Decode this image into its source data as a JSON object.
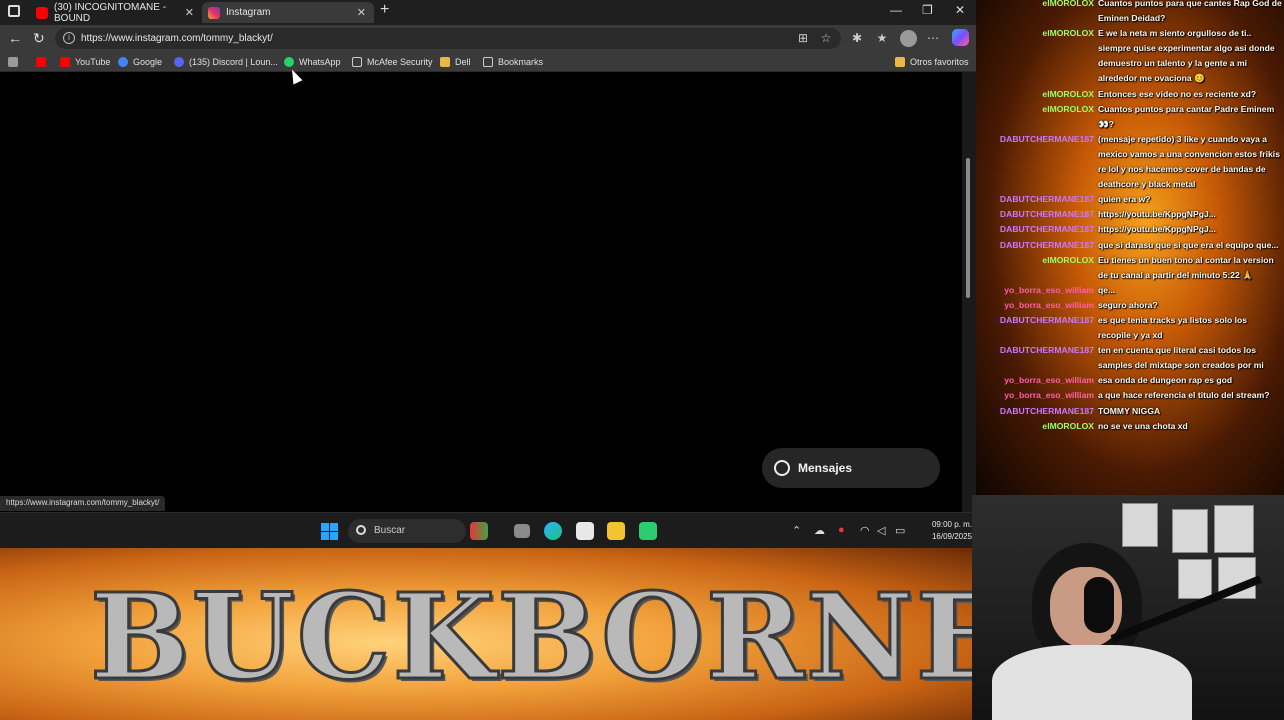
{
  "browser": {
    "tabs": [
      {
        "label": "(30) INCOGNITOMANE - BOUND",
        "favicon_color": "#ff0000"
      },
      {
        "label": "Instagram",
        "favicon_color": "#e1306c"
      }
    ],
    "url": "https://www.instagram.com/tommy_blackyt/",
    "bookmarks": [
      {
        "label": "YouTube",
        "icon_color": "#ff0000"
      },
      {
        "label": "Google",
        "icon_color": "#4285f4"
      },
      {
        "label": "(135) Discord | Loun...",
        "icon_color": "#5865f2"
      },
      {
        "label": "WhatsApp",
        "icon_color": "#25d366"
      },
      {
        "label": "McAfee Security",
        "icon_color": "#cccccc"
      },
      {
        "label": "Dell",
        "icon_color": "#e8b94a"
      },
      {
        "label": "Bookmarks",
        "icon_color": "#cccccc"
      }
    ],
    "other_favorites": "Otros favoritos",
    "messages_button": "Mensajes",
    "status_url": "https://www.instagram.com/tommy_blackyt/"
  },
  "taskbar": {
    "search_label": "Buscar",
    "time": "09:00 p. m.",
    "date": "16/09/2025"
  },
  "banner": {
    "text": "BUCKBORNE"
  },
  "chat": {
    "messages": [
      {
        "user": "elMOROLOX",
        "user_color": "#9bff6a",
        "text": "Cuantos puntos para que cantes Rap God de Eminen Deidad?"
      },
      {
        "user": "elMOROLOX",
        "user_color": "#9bff6a",
        "text": "E we la neta m siento orgulloso de ti.. siempre quise experimentar algo asi donde demuestro un talento y la gente a mi alrededor me ovaciona 😊"
      },
      {
        "user": "elMOROLOX",
        "user_color": "#9bff6a",
        "text": "Entonces ese video no es reciente xd?"
      },
      {
        "user": "elMOROLOX",
        "user_color": "#9bff6a",
        "text": "Cuantos puntos para cantar Padre Eminem 👀?"
      },
      {
        "user": "DABUTCHERMANE187",
        "user_color": "#c978ff",
        "text": "(mensaje repetido) 3 like y cuando vaya a mexico vamos a una convencion estos frikis re lol y nos hacemos cover de bandas de deathcore y black metal"
      },
      {
        "user": "DABUTCHERMANE187",
        "user_color": "#c978ff",
        "text": "quien era w?"
      },
      {
        "user": "DABUTCHERMANE187",
        "user_color": "#c978ff",
        "text": "https://youtu.be/KppgNPgJ..."
      },
      {
        "user": "DABUTCHERMANE187",
        "user_color": "#c978ff",
        "text": "https://youtu.be/KppgNPgJ..."
      },
      {
        "user": "DABUTCHERMANE187",
        "user_color": "#c978ff",
        "text": "que si darasu que si que era el equipo que..."
      },
      {
        "user": "elMOROLOX",
        "user_color": "#9bff6a",
        "text": "Eu tienes un buen tono al contar la version de tu canal a partir del minuto 5:22 🙏"
      },
      {
        "user": "yo_borra_eso_william",
        "user_color": "#ff5fa8",
        "text": "qe..."
      },
      {
        "user": "yo_borra_eso_william",
        "user_color": "#ff5fa8",
        "text": "seguro ahora?"
      },
      {
        "user": "DABUTCHERMANE187",
        "user_color": "#c978ff",
        "text": "es que tenia tracks ya listos solo los recopile y ya xd"
      },
      {
        "user": "DABUTCHERMANE187",
        "user_color": "#c978ff",
        "text": "ten en cuenta que literal casi todos los samples del mixtape son creados por mi"
      },
      {
        "user": "yo_borra_eso_william",
        "user_color": "#ff5fa8",
        "text": "esa onda de dungeon rap es god"
      },
      {
        "user": "yo_borra_eso_william",
        "user_color": "#ff5fa8",
        "text": "a que hace referencia el titulo del stream?"
      },
      {
        "user": "DABUTCHERMANE187",
        "user_color": "#c978ff",
        "text": "TOMMY NIGGA"
      },
      {
        "user": "elMOROLOX",
        "user_color": "#9bff6a",
        "text": "no se ve una chota xd"
      }
    ]
  }
}
